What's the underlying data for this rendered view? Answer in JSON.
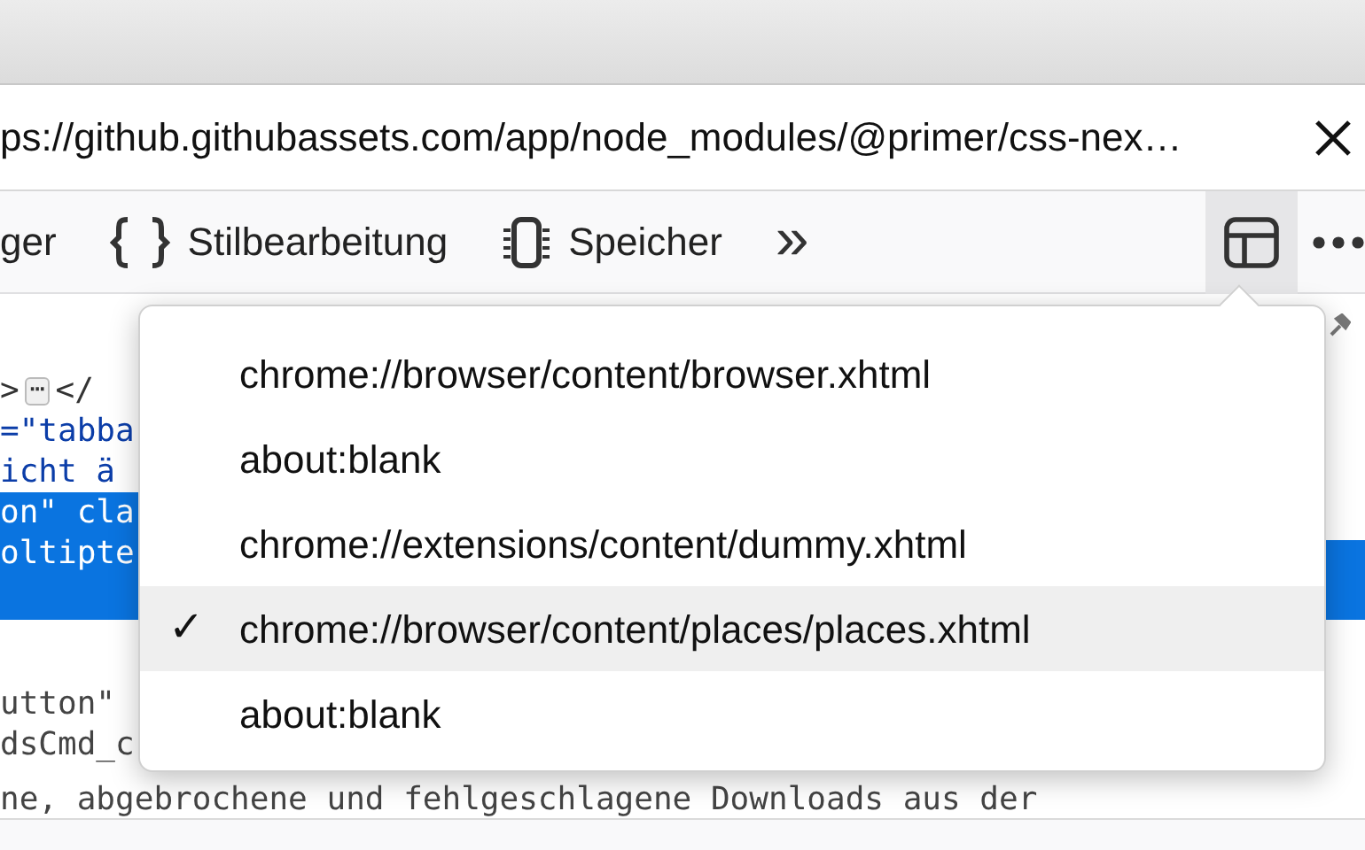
{
  "url_bar": {
    "url": "ps://github.githubassets.com/app/node_modules/@primer/css-nex…"
  },
  "toolbar": {
    "tabs": [
      {
        "label": "ger",
        "kind": "text"
      },
      {
        "label": "Stilbearbeitung",
        "kind": "braces"
      },
      {
        "label": "Speicher",
        "kind": "chip"
      }
    ],
    "overflow": "»"
  },
  "code_lines": [
    {
      "text": ">",
      "badge": "⋯",
      "after": "</",
      "selected": false,
      "kind": "markup"
    },
    {
      "text": "=\"tabba",
      "selected": false,
      "kind": "value"
    },
    {
      "text": "icht ä",
      "selected": false,
      "kind": "value"
    },
    {
      "text": "on\" cla",
      "selected": true,
      "kind": "plain"
    },
    {
      "text": "oltipte",
      "selected": true,
      "kind": "plain"
    },
    {
      "text": "utton\"",
      "selected": false,
      "kind": "plain"
    },
    {
      "text": "dsCmd_c",
      "selected": false,
      "kind": "plain"
    },
    {
      "text": "ne, abgebrochene und fehlgeschlagene Downloads aus der",
      "selected": false,
      "kind": "plain"
    }
  ],
  "frame_menu": {
    "items": [
      {
        "label": "chrome://browser/content/browser.xhtml",
        "selected": false
      },
      {
        "label": "about:blank",
        "selected": false
      },
      {
        "label": "chrome://extensions/content/dummy.xhtml",
        "selected": false
      },
      {
        "label": "chrome://browser/content/places/places.xhtml",
        "selected": true
      },
      {
        "label": "about:blank",
        "selected": false
      }
    ],
    "check": "✓"
  }
}
